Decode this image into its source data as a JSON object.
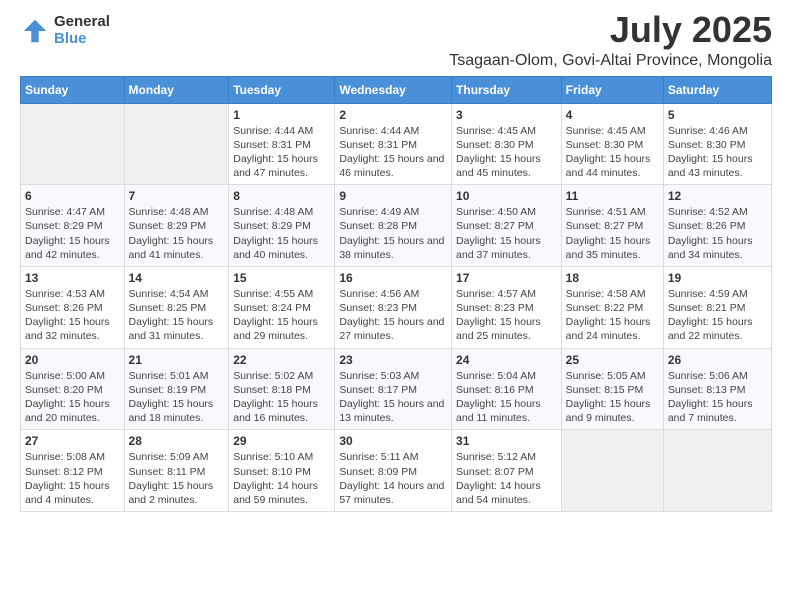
{
  "logo": {
    "general": "General",
    "blue": "Blue"
  },
  "title": "July 2025",
  "subtitle": "Tsagaan-Olom, Govi-Altai Province, Mongolia",
  "headers": [
    "Sunday",
    "Monday",
    "Tuesday",
    "Wednesday",
    "Thursday",
    "Friday",
    "Saturday"
  ],
  "weeks": [
    [
      {
        "day": "",
        "sunrise": "",
        "sunset": "",
        "daylight": ""
      },
      {
        "day": "",
        "sunrise": "",
        "sunset": "",
        "daylight": ""
      },
      {
        "day": "1",
        "sunrise": "Sunrise: 4:44 AM",
        "sunset": "Sunset: 8:31 PM",
        "daylight": "Daylight: 15 hours and 47 minutes."
      },
      {
        "day": "2",
        "sunrise": "Sunrise: 4:44 AM",
        "sunset": "Sunset: 8:31 PM",
        "daylight": "Daylight: 15 hours and 46 minutes."
      },
      {
        "day": "3",
        "sunrise": "Sunrise: 4:45 AM",
        "sunset": "Sunset: 8:30 PM",
        "daylight": "Daylight: 15 hours and 45 minutes."
      },
      {
        "day": "4",
        "sunrise": "Sunrise: 4:45 AM",
        "sunset": "Sunset: 8:30 PM",
        "daylight": "Daylight: 15 hours and 44 minutes."
      },
      {
        "day": "5",
        "sunrise": "Sunrise: 4:46 AM",
        "sunset": "Sunset: 8:30 PM",
        "daylight": "Daylight: 15 hours and 43 minutes."
      }
    ],
    [
      {
        "day": "6",
        "sunrise": "Sunrise: 4:47 AM",
        "sunset": "Sunset: 8:29 PM",
        "daylight": "Daylight: 15 hours and 42 minutes."
      },
      {
        "day": "7",
        "sunrise": "Sunrise: 4:48 AM",
        "sunset": "Sunset: 8:29 PM",
        "daylight": "Daylight: 15 hours and 41 minutes."
      },
      {
        "day": "8",
        "sunrise": "Sunrise: 4:48 AM",
        "sunset": "Sunset: 8:29 PM",
        "daylight": "Daylight: 15 hours and 40 minutes."
      },
      {
        "day": "9",
        "sunrise": "Sunrise: 4:49 AM",
        "sunset": "Sunset: 8:28 PM",
        "daylight": "Daylight: 15 hours and 38 minutes."
      },
      {
        "day": "10",
        "sunrise": "Sunrise: 4:50 AM",
        "sunset": "Sunset: 8:27 PM",
        "daylight": "Daylight: 15 hours and 37 minutes."
      },
      {
        "day": "11",
        "sunrise": "Sunrise: 4:51 AM",
        "sunset": "Sunset: 8:27 PM",
        "daylight": "Daylight: 15 hours and 35 minutes."
      },
      {
        "day": "12",
        "sunrise": "Sunrise: 4:52 AM",
        "sunset": "Sunset: 8:26 PM",
        "daylight": "Daylight: 15 hours and 34 minutes."
      }
    ],
    [
      {
        "day": "13",
        "sunrise": "Sunrise: 4:53 AM",
        "sunset": "Sunset: 8:26 PM",
        "daylight": "Daylight: 15 hours and 32 minutes."
      },
      {
        "day": "14",
        "sunrise": "Sunrise: 4:54 AM",
        "sunset": "Sunset: 8:25 PM",
        "daylight": "Daylight: 15 hours and 31 minutes."
      },
      {
        "day": "15",
        "sunrise": "Sunrise: 4:55 AM",
        "sunset": "Sunset: 8:24 PM",
        "daylight": "Daylight: 15 hours and 29 minutes."
      },
      {
        "day": "16",
        "sunrise": "Sunrise: 4:56 AM",
        "sunset": "Sunset: 8:23 PM",
        "daylight": "Daylight: 15 hours and 27 minutes."
      },
      {
        "day": "17",
        "sunrise": "Sunrise: 4:57 AM",
        "sunset": "Sunset: 8:23 PM",
        "daylight": "Daylight: 15 hours and 25 minutes."
      },
      {
        "day": "18",
        "sunrise": "Sunrise: 4:58 AM",
        "sunset": "Sunset: 8:22 PM",
        "daylight": "Daylight: 15 hours and 24 minutes."
      },
      {
        "day": "19",
        "sunrise": "Sunrise: 4:59 AM",
        "sunset": "Sunset: 8:21 PM",
        "daylight": "Daylight: 15 hours and 22 minutes."
      }
    ],
    [
      {
        "day": "20",
        "sunrise": "Sunrise: 5:00 AM",
        "sunset": "Sunset: 8:20 PM",
        "daylight": "Daylight: 15 hours and 20 minutes."
      },
      {
        "day": "21",
        "sunrise": "Sunrise: 5:01 AM",
        "sunset": "Sunset: 8:19 PM",
        "daylight": "Daylight: 15 hours and 18 minutes."
      },
      {
        "day": "22",
        "sunrise": "Sunrise: 5:02 AM",
        "sunset": "Sunset: 8:18 PM",
        "daylight": "Daylight: 15 hours and 16 minutes."
      },
      {
        "day": "23",
        "sunrise": "Sunrise: 5:03 AM",
        "sunset": "Sunset: 8:17 PM",
        "daylight": "Daylight: 15 hours and 13 minutes."
      },
      {
        "day": "24",
        "sunrise": "Sunrise: 5:04 AM",
        "sunset": "Sunset: 8:16 PM",
        "daylight": "Daylight: 15 hours and 11 minutes."
      },
      {
        "day": "25",
        "sunrise": "Sunrise: 5:05 AM",
        "sunset": "Sunset: 8:15 PM",
        "daylight": "Daylight: 15 hours and 9 minutes."
      },
      {
        "day": "26",
        "sunrise": "Sunrise: 5:06 AM",
        "sunset": "Sunset: 8:13 PM",
        "daylight": "Daylight: 15 hours and 7 minutes."
      }
    ],
    [
      {
        "day": "27",
        "sunrise": "Sunrise: 5:08 AM",
        "sunset": "Sunset: 8:12 PM",
        "daylight": "Daylight: 15 hours and 4 minutes."
      },
      {
        "day": "28",
        "sunrise": "Sunrise: 5:09 AM",
        "sunset": "Sunset: 8:11 PM",
        "daylight": "Daylight: 15 hours and 2 minutes."
      },
      {
        "day": "29",
        "sunrise": "Sunrise: 5:10 AM",
        "sunset": "Sunset: 8:10 PM",
        "daylight": "Daylight: 14 hours and 59 minutes."
      },
      {
        "day": "30",
        "sunrise": "Sunrise: 5:11 AM",
        "sunset": "Sunset: 8:09 PM",
        "daylight": "Daylight: 14 hours and 57 minutes."
      },
      {
        "day": "31",
        "sunrise": "Sunrise: 5:12 AM",
        "sunset": "Sunset: 8:07 PM",
        "daylight": "Daylight: 14 hours and 54 minutes."
      },
      {
        "day": "",
        "sunrise": "",
        "sunset": "",
        "daylight": ""
      },
      {
        "day": "",
        "sunrise": "",
        "sunset": "",
        "daylight": ""
      }
    ]
  ]
}
